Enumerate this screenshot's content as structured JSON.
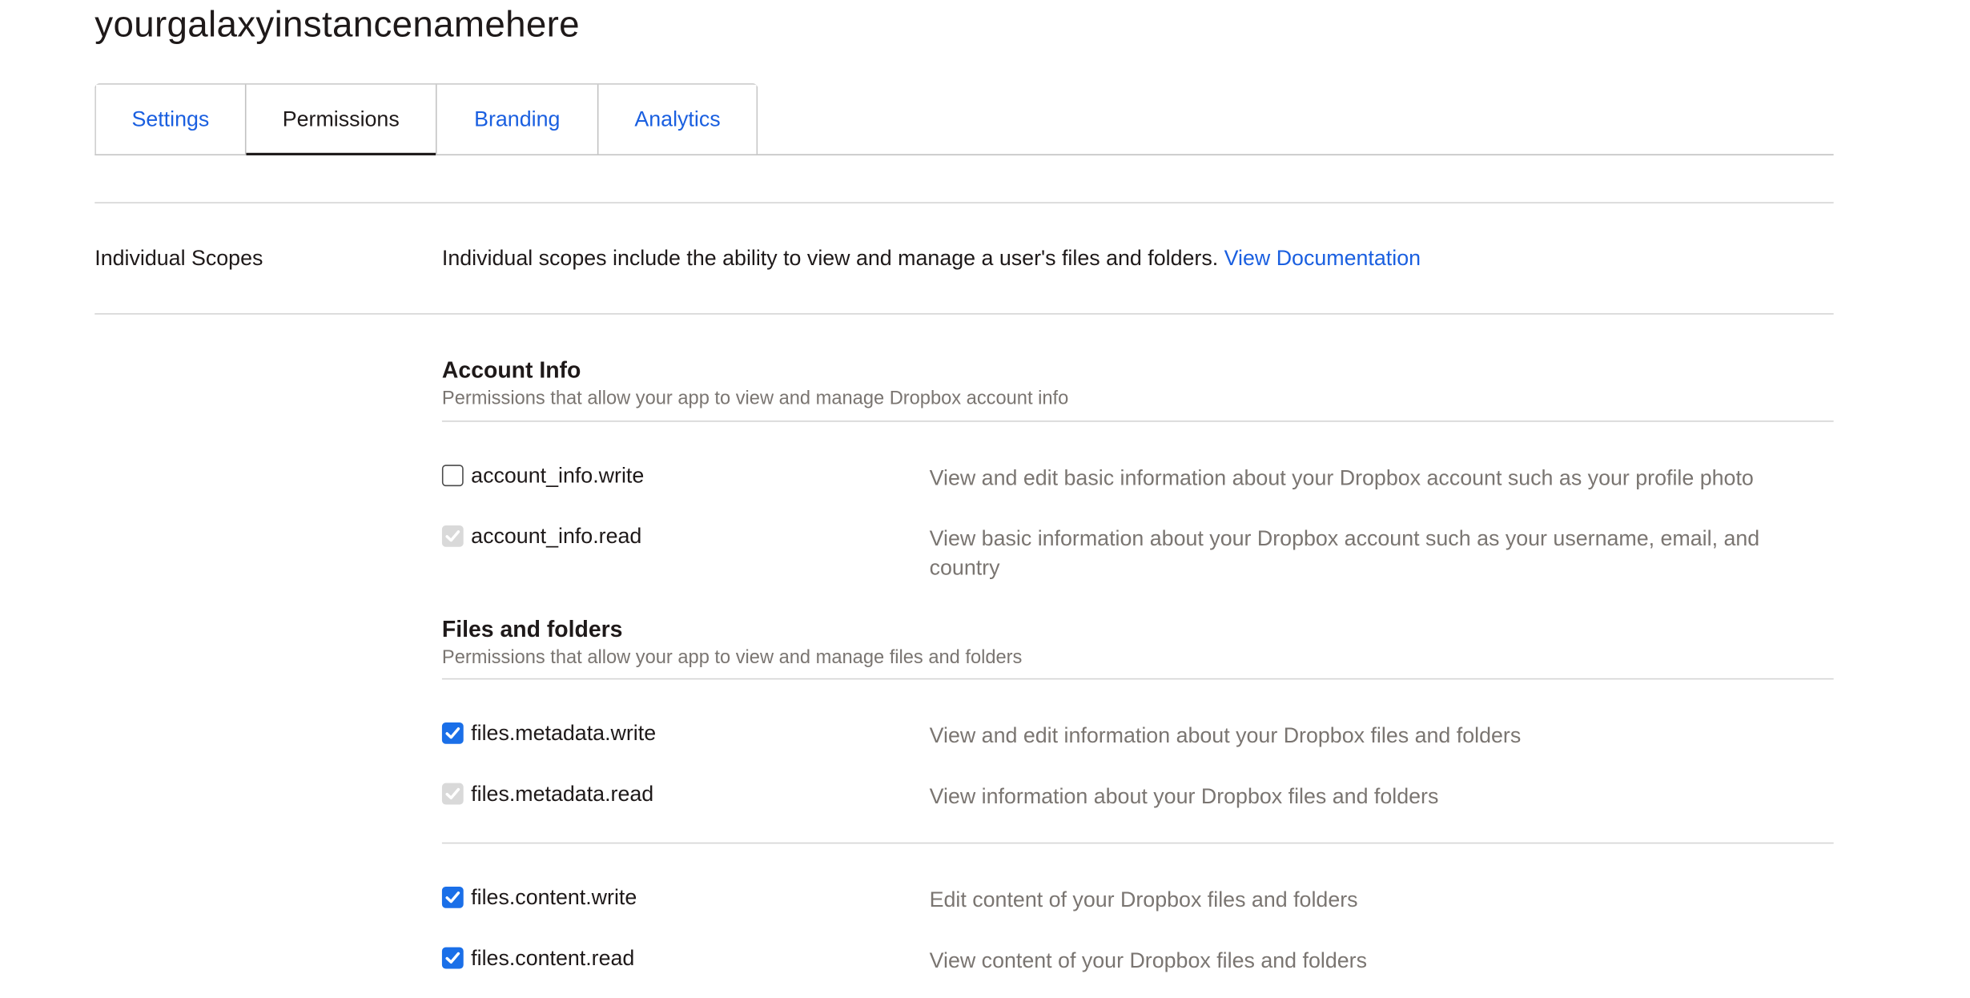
{
  "app": {
    "title": "yourgalaxyinstancenamehere"
  },
  "tabs": [
    {
      "label": "Settings",
      "active": false
    },
    {
      "label": "Permissions",
      "active": true
    },
    {
      "label": "Branding",
      "active": false
    },
    {
      "label": "Analytics",
      "active": false
    }
  ],
  "scopes": {
    "label": "Individual Scopes",
    "description": "Individual scopes include the ability to view and manage a user's files and folders.",
    "doc_link": "View Documentation"
  },
  "sections": {
    "account_info": {
      "title": "Account Info",
      "subtitle": "Permissions that allow your app to view and manage Dropbox account info",
      "permissions": [
        {
          "name": "account_info.write",
          "description": "View and edit basic information about your Dropbox account such as your profile photo",
          "state": "unchecked"
        },
        {
          "name": "account_info.read",
          "description": "View basic information about your Dropbox account such as your username, email, and country",
          "state": "checked-disabled"
        }
      ]
    },
    "files": {
      "title": "Files and folders",
      "subtitle": "Permissions that allow your app to view and manage files and folders",
      "permissions": [
        {
          "name": "files.metadata.write",
          "description": "View and edit information about your Dropbox files and folders",
          "state": "checked"
        },
        {
          "name": "files.metadata.read",
          "description": "View information about your Dropbox files and folders",
          "state": "checked-disabled"
        },
        {
          "name": "files.content.write",
          "description": "Edit content of your Dropbox files and folders",
          "state": "checked"
        },
        {
          "name": "files.content.read",
          "description": "View content of your Dropbox files and folders",
          "state": "checked"
        }
      ]
    }
  },
  "colors": {
    "link": "#1a5fe0",
    "checkbox_checked": "#1a6fe8",
    "checkbox_disabled": "#d9d9d9",
    "muted_text": "#7a7571"
  }
}
